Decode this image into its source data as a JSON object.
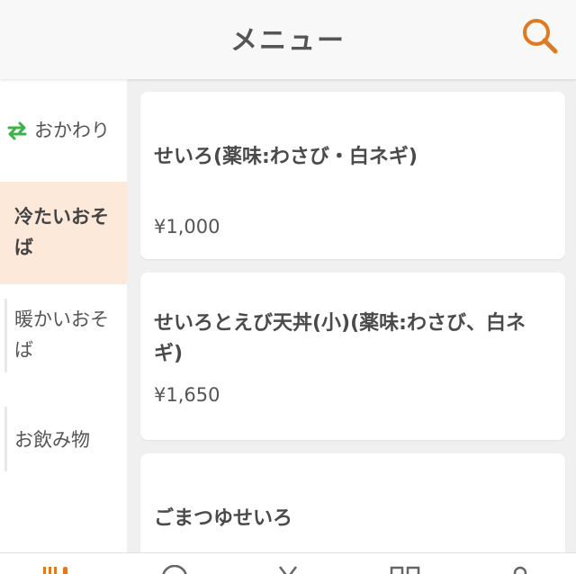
{
  "header": {
    "title": "メニュー",
    "search_icon": "search-icon",
    "accent_color": "#e07a22"
  },
  "sidebar": {
    "items": [
      {
        "label": "おかわり",
        "icon": "refresh-icon",
        "icon_color": "#3cb34a",
        "active": false
      },
      {
        "label": "冷たいおそば",
        "active": true
      },
      {
        "label": "暖かいおそば",
        "active": false
      },
      {
        "label": "お飲み物",
        "active": false
      }
    ],
    "active_bg": "#fde9da"
  },
  "menu_items": [
    {
      "name": "せいろ(薬味:わさび・白ネギ)",
      "price": "¥1,000"
    },
    {
      "name": "せいろとえび天丼(小)(薬味:わさび、白ネギ)",
      "price": "¥1,650"
    },
    {
      "name": "ごまつゆせいろ",
      "price": ""
    }
  ],
  "bottom_nav": {
    "icons": [
      "menu-icon",
      "history-icon",
      "ordered-icon",
      "qr-code-icon",
      "account-icon"
    ],
    "active_color": "#e07a22"
  }
}
